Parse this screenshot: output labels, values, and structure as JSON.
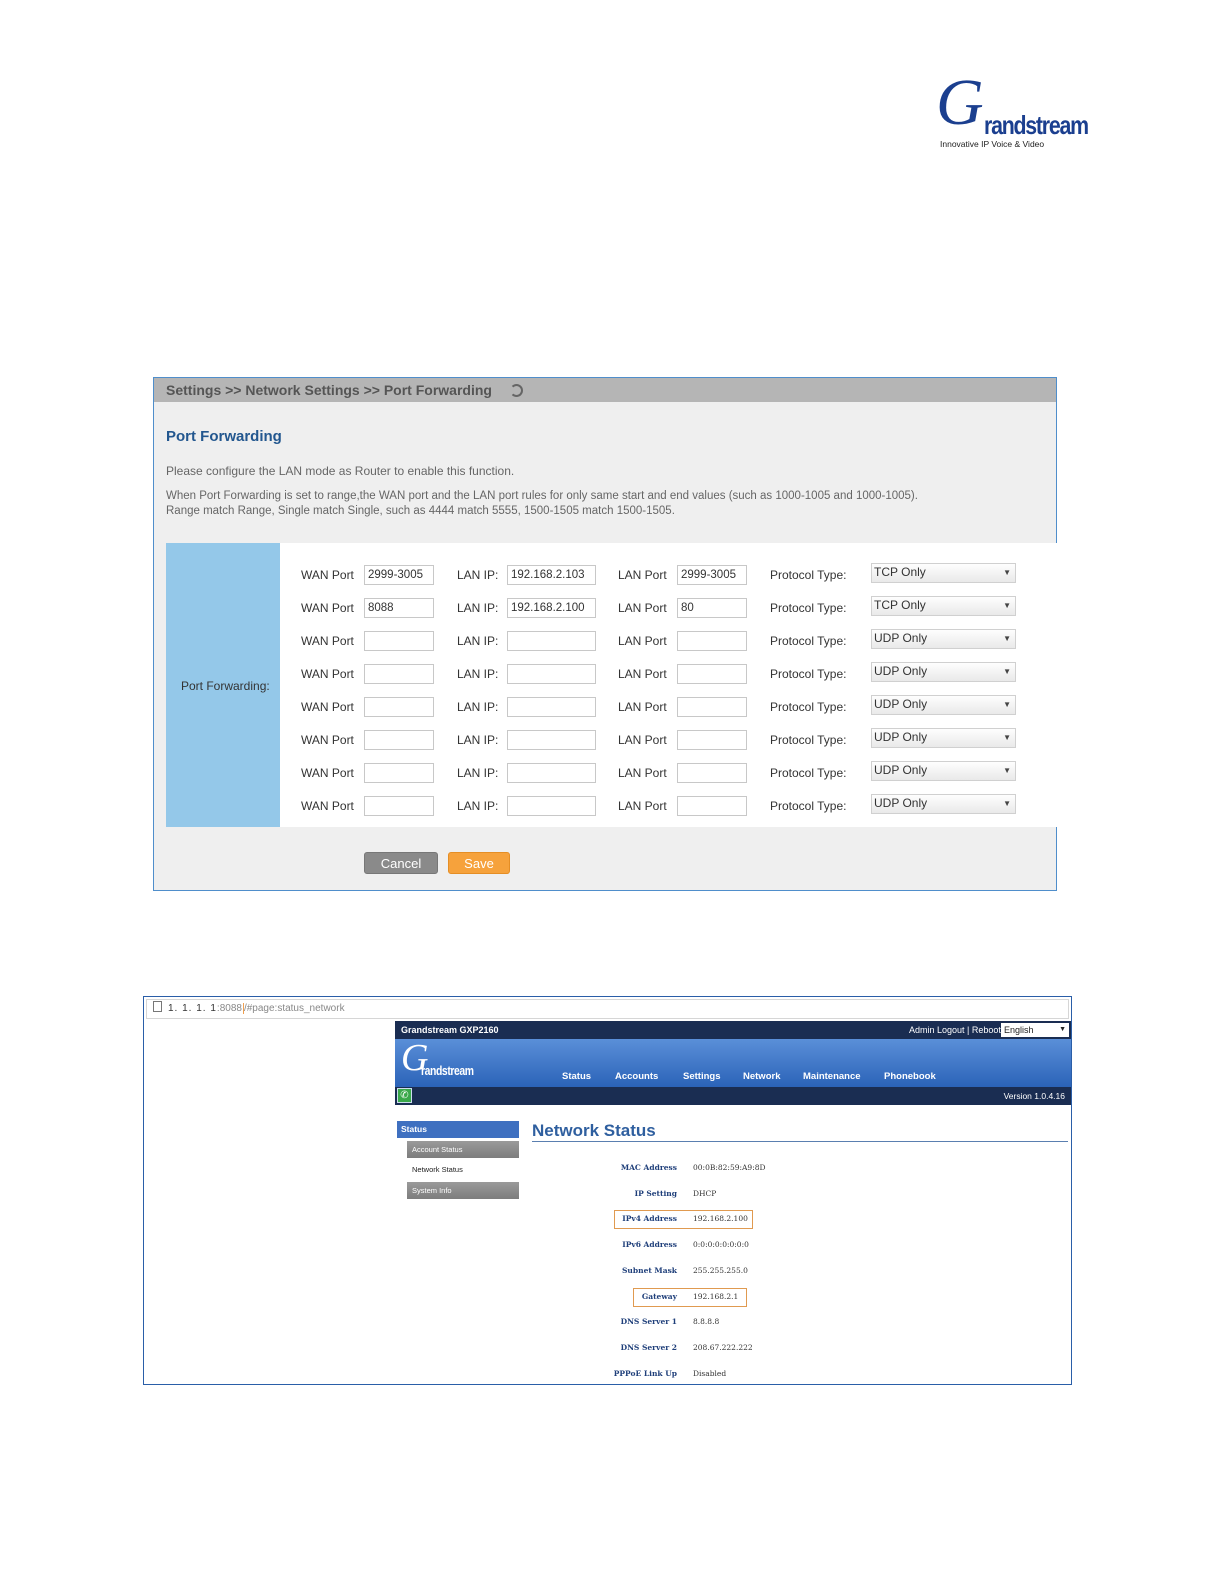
{
  "logo": {
    "brand": "randstream",
    "letter": "G",
    "tagline": "Innovative IP Voice & Video"
  },
  "port_forwarding": {
    "breadcrumb": "Settings >> Network Settings >> Port Forwarding",
    "refresh_icon": "refresh-icon",
    "title": "Port Forwarding",
    "note1": "Please configure the LAN mode as Router to enable this function.",
    "note2": "When Port Forwarding is set to range,the WAN port and the LAN port rules for only same start and end values (such as 1000-1005 and 1000-1005).",
    "note3": "Range match Range, Single match Single, such as 4444 match 5555, 1500-1505 match 1500-1505.",
    "side_label": "Port Forwarding:",
    "labels": {
      "wan": "WAN Port",
      "lan_ip": "LAN IP:",
      "lan_port": "LAN Port",
      "protocol": "Protocol Type:"
    },
    "rows": [
      {
        "wan": "2999-3005",
        "lan_ip": "192.168.2.103",
        "lan_port": "2999-3005",
        "protocol": "TCP Only"
      },
      {
        "wan": "8088",
        "lan_ip": "192.168.2.100",
        "lan_port": "80",
        "protocol": "TCP Only"
      },
      {
        "wan": "",
        "lan_ip": "",
        "lan_port": "",
        "protocol": "UDP Only"
      },
      {
        "wan": "",
        "lan_ip": "",
        "lan_port": "",
        "protocol": "UDP Only"
      },
      {
        "wan": "",
        "lan_ip": "",
        "lan_port": "",
        "protocol": "UDP Only"
      },
      {
        "wan": "",
        "lan_ip": "",
        "lan_port": "",
        "protocol": "UDP Only"
      },
      {
        "wan": "",
        "lan_ip": "",
        "lan_port": "",
        "protocol": "UDP Only"
      },
      {
        "wan": "",
        "lan_ip": "",
        "lan_port": "",
        "protocol": "UDP Only"
      }
    ],
    "cancel_label": "Cancel",
    "save_label": "Save",
    "colors": {
      "save": "#f6a23c",
      "cancel": "#8a8a8a",
      "side": "#94c8e9",
      "title": "#23578f"
    }
  },
  "network_status": {
    "url": {
      "host": "1. 1. 1. 1",
      "port": ":8088",
      "path": "/#page:status_network"
    },
    "model": "Grandstream GXP2160",
    "top_links": "Admin Logout | Reboot",
    "language": "English",
    "mini_logo_letter": "G",
    "mini_logo_word": "randstream",
    "menu": [
      "Status",
      "Accounts",
      "Settings",
      "Network",
      "Maintenance",
      "Phonebook"
    ],
    "version": "Version 1.0.4.16",
    "side_menu": {
      "head": "Status",
      "items": [
        "Account Status",
        "Network Status",
        "System Info"
      ]
    },
    "title": "Network Status",
    "fields": [
      {
        "key": "MAC Address",
        "value": "00:0B:82:59:A9:8D"
      },
      {
        "key": "IP Setting",
        "value": "DHCP"
      },
      {
        "key": "IPv4 Address",
        "value": "192.168.2.100"
      },
      {
        "key": "IPv6 Address",
        "value": "0:0:0:0:0:0:0:0"
      },
      {
        "key": "Subnet Mask",
        "value": "255.255.255.0"
      },
      {
        "key": "Gateway",
        "value": "192.168.2.1"
      },
      {
        "key": "DNS Server 1",
        "value": "8.8.8.8"
      },
      {
        "key": "DNS Server 2",
        "value": "208.67.222.222"
      },
      {
        "key": "PPPoE Link Up",
        "value": "Disabled"
      }
    ],
    "colors": {
      "topbar": "#1a2d52",
      "nav": "#2b63b8",
      "title": "#2f5f9f",
      "highlight": "#e09a50"
    }
  }
}
